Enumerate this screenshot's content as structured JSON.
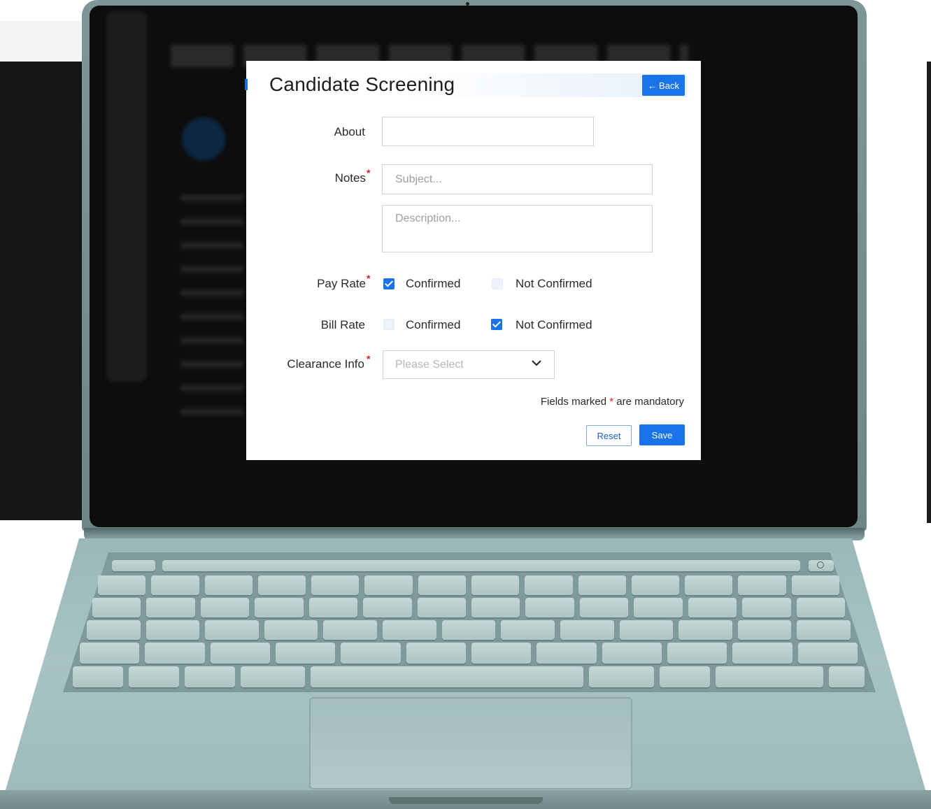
{
  "modal": {
    "title": "Candidate Screening",
    "back_label": "Back",
    "fields": {
      "about": {
        "label": "About",
        "value": ""
      },
      "notes": {
        "label": "Notes",
        "required_mark": "*",
        "subject_placeholder": "Subject...",
        "description_placeholder": "Description..."
      },
      "pay_rate": {
        "label": "Pay Rate",
        "required_mark": "*",
        "option_confirmed": "Confirmed",
        "option_not_confirmed": "Not Confirmed",
        "selected": "Confirmed"
      },
      "bill_rate": {
        "label": "Bill Rate",
        "option_confirmed": "Confirmed",
        "option_not_confirmed": "Not Confirmed",
        "selected": "Not Confirmed"
      },
      "clearance_info": {
        "label": "Clearance Info",
        "required_mark": "*",
        "placeholder": "Please Select"
      }
    },
    "mandatory_note": {
      "prefix": "Fields marked",
      "star": "*",
      "suffix": "are mandatory"
    },
    "reset_label": "Reset",
    "save_label": "Save"
  },
  "colors": {
    "accent": "#1a73e8",
    "required": "#e0181f",
    "laptop_body": "#9bb7b7"
  },
  "icons": {
    "back": "arrow-left-icon",
    "dropdown": "chevron-down-icon",
    "power": "power-icon"
  }
}
